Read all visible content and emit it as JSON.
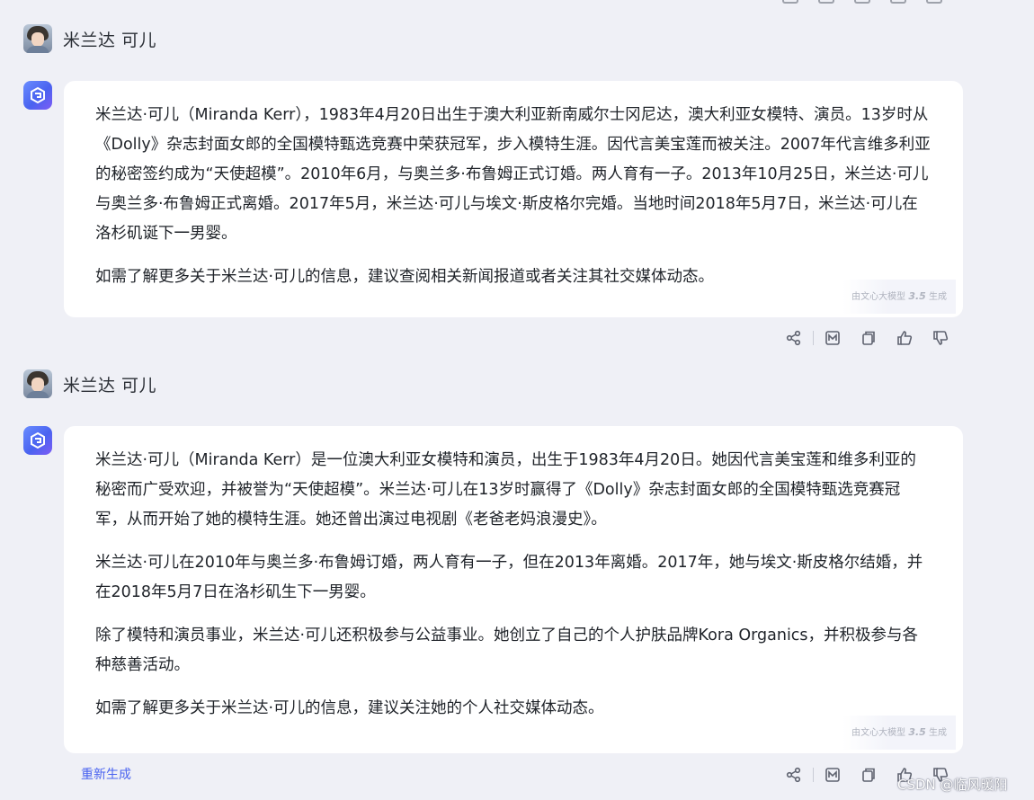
{
  "user": {
    "name": "米兰达 可儿"
  },
  "responses": [
    {
      "paragraphs": [
        "米兰达·可儿（Miranda Kerr），1983年4月20日出生于澳大利亚新南威尔士冈尼达，澳大利亚女模特、演员。13岁时从《Dolly》杂志封面女郎的全国模特甄选竞赛中荣获冠军，步入模特生涯。因代言美宝莲而被关注。2007年代言维多利亚的秘密签约成为“天使超模”。2010年6月，与奥兰多·布鲁姆正式订婚。两人育有一子。2013年10月25日，米兰达·可儿与奥兰多·布鲁姆正式离婚。2017年5月，米兰达·可儿与埃文·斯皮格尔完婚。当地时间2018年5月7日，米兰达·可儿在洛杉矶诞下一男婴。",
        "如需了解更多关于米兰达·可儿的信息，建议查阅相关新闻报道或者关注其社交媒体动态。"
      ],
      "watermark_prefix": "由文心大模型",
      "watermark_version": "3.5",
      "watermark_suffix": "生成"
    },
    {
      "paragraphs": [
        "米兰达·可儿（Miranda Kerr）是一位澳大利亚女模特和演员，出生于1983年4月20日。她因代言美宝莲和维多利亚的秘密而广受欢迎，并被誉为“天使超模”。米兰达·可儿在13岁时赢得了《Dolly》杂志封面女郎的全国模特甄选竞赛冠军，从而开始了她的模特生涯。她还曾出演过电视剧《老爸老妈浪漫史》。",
        "米兰达·可儿在2010年与奥兰多·布鲁姆订婚，两人育有一子，但在2013年离婚。2017年，她与埃文·斯皮格尔结婚，并在2018年5月7日在洛杉矶生下一男婴。",
        "除了模特和演员事业，米兰达·可儿还积极参与公益事业。她创立了自己的个人护肤品牌Kora Organics，并积极参与各种慈善活动。",
        "如需了解更多关于米兰达·可儿的信息，建议关注她的个人社交媒体动态。"
      ],
      "watermark_prefix": "由文心大模型",
      "watermark_version": "3.5",
      "watermark_suffix": "生成"
    }
  ],
  "actions": [
    "share-icon",
    "mindmap-icon",
    "copy-icon",
    "thumbs-up-icon",
    "thumbs-down-icon"
  ],
  "regenerate_label": "重新生成",
  "csdn_watermark": "CSDN @临风暖阳",
  "colors": {
    "accent": "#4a63f0",
    "background": "#eff0f6",
    "bubble": "#ffffff"
  }
}
